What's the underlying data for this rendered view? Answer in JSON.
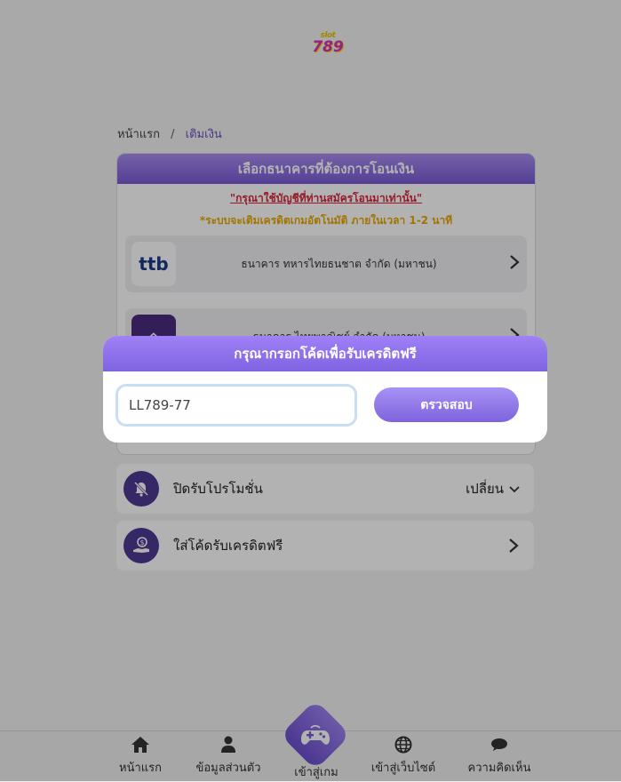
{
  "logo": {
    "line1": "slot",
    "line2": "789"
  },
  "breadcrumb": {
    "home": "หน้าแรก",
    "separator": "/",
    "current": "เติมเงิน"
  },
  "bank_panel": {
    "title": "เลือกธนาคารที่ต้องการโอนเงิน",
    "notice_red": "\"กรุณาใช้บัญชีที่ท่านสมัครโอนมาเท่านั้น\"",
    "notice_yellow": "*ระบบจะเติมเครดิตเกมอัตโนมัติ ภายในเวลา 1-2 นาที",
    "banks": [
      {
        "logo_text": "ttb",
        "name": "ธนาคาร ทหารไทยธนชาต จำกัด (มหาชน)"
      },
      {
        "logo_text": "⌂",
        "name": "ธนาคาร ไทยพาณิชย์ จำกัด (มหาชน)"
      }
    ]
  },
  "promo_row": {
    "label": "ปิดรับโปรโมชั่น",
    "action": "เปลี่ยน"
  },
  "freecode_row": {
    "label": "ใส่โค้ดรับเครดิตฟรี"
  },
  "modal": {
    "title": "กรุณากรอกโค้ดเพื่อรับเครดิตฟรี",
    "input_value": "LL789-77",
    "button": "ตรวจสอบ"
  },
  "bottom_nav": {
    "home": "หน้าแรก",
    "profile": "ข้อมูลส่วนตัว",
    "play": "เข้าสู่เกม",
    "website": "เข้าสู่เว็บไซต์",
    "feedback": "ความคิดเห็น"
  },
  "colors": {
    "accent": "#7a5ad6",
    "icon_bg": "#4e3a94",
    "notice_red": "#d7263d",
    "notice_yellow": "#e7a800"
  }
}
